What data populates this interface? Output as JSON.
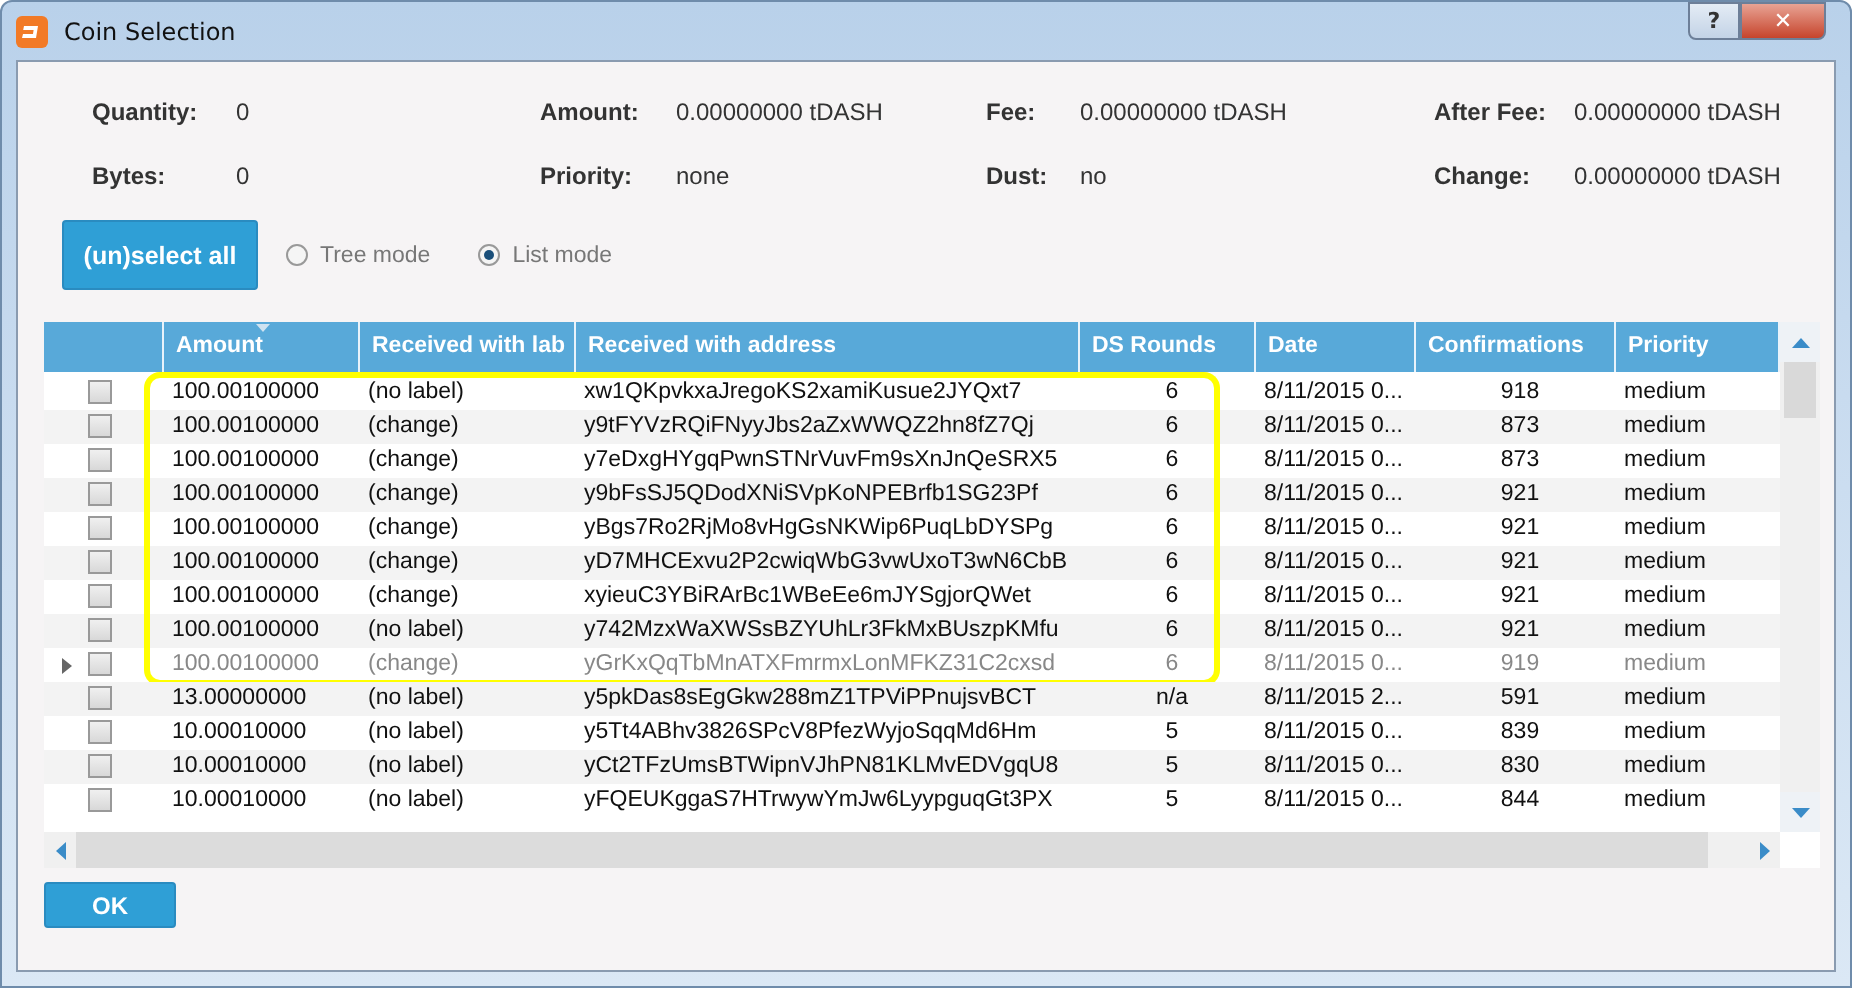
{
  "window": {
    "title": "Coin Selection",
    "help": "?",
    "close": "✕"
  },
  "summary": [
    {
      "label": "Quantity:",
      "value": "0"
    },
    {
      "label": "Amount:",
      "value": "0.00000000 tDASH"
    },
    {
      "label": "Fee:",
      "value": "0.00000000 tDASH"
    },
    {
      "label": "After Fee:",
      "value": "0.00000000 tDASH"
    },
    {
      "label": "Bytes:",
      "value": "0"
    },
    {
      "label": "Priority:",
      "value": "none"
    },
    {
      "label": "Dust:",
      "value": "no"
    },
    {
      "label": "Change:",
      "value": "0.00000000 tDASH"
    }
  ],
  "select_all": "(un)select all",
  "modes": [
    {
      "label": "Tree mode",
      "selected": false
    },
    {
      "label": "List mode",
      "selected": true
    }
  ],
  "table": {
    "columns": [
      "Amount",
      "Received with lab",
      "Received with address",
      "DS Rounds",
      "Date",
      "Confirmations",
      "Priority"
    ],
    "rows": [
      {
        "checked": false,
        "current": false,
        "greyed": false,
        "highlighted": true,
        "cells": [
          "100.00100000",
          "(no label)",
          "xw1QKpvkxaJregoKS2xamiKusue2JYQxt7",
          "6",
          "8/11/2015 0...",
          "918",
          "medium"
        ]
      },
      {
        "checked": false,
        "current": false,
        "greyed": false,
        "highlighted": true,
        "cells": [
          "100.00100000",
          "(change)",
          "y9tFYVzRQiFNyyJbs2aZxWWQZ2hn8fZ7Qj",
          "6",
          "8/11/2015 0...",
          "873",
          "medium"
        ]
      },
      {
        "checked": false,
        "current": false,
        "greyed": false,
        "highlighted": true,
        "cells": [
          "100.00100000",
          "(change)",
          "y7eDxgHYgqPwnSTNrVuvFm9sXnJnQeSRX5",
          "6",
          "8/11/2015 0...",
          "873",
          "medium"
        ]
      },
      {
        "checked": false,
        "current": false,
        "greyed": false,
        "highlighted": true,
        "cells": [
          "100.00100000",
          "(change)",
          "y9bFsSJ5QDodXNiSVpKoNPEBrfb1SG23Pf",
          "6",
          "8/11/2015 0...",
          "921",
          "medium"
        ]
      },
      {
        "checked": false,
        "current": false,
        "greyed": false,
        "highlighted": true,
        "cells": [
          "100.00100000",
          "(change)",
          "yBgs7Ro2RjMo8vHgGsNKWip6PuqLbDYSPg",
          "6",
          "8/11/2015 0...",
          "921",
          "medium"
        ]
      },
      {
        "checked": false,
        "current": false,
        "greyed": false,
        "highlighted": true,
        "cells": [
          "100.00100000",
          "(change)",
          "yD7MHCExvu2P2cwiqWbG3vwUxoT3wN6CbB",
          "6",
          "8/11/2015 0...",
          "921",
          "medium"
        ]
      },
      {
        "checked": false,
        "current": false,
        "greyed": false,
        "highlighted": true,
        "cells": [
          "100.00100000",
          "(change)",
          "xyieuC3YBiRArBc1WBeEe6mJYSgjorQWet",
          "6",
          "8/11/2015 0...",
          "921",
          "medium"
        ]
      },
      {
        "checked": false,
        "current": false,
        "greyed": false,
        "highlighted": true,
        "cells": [
          "100.00100000",
          "(no label)",
          "y742MzxWaXWSsBZYUhLr3FkMxBUszpKMfu",
          "6",
          "8/11/2015 0...",
          "921",
          "medium"
        ]
      },
      {
        "checked": false,
        "current": true,
        "greyed": true,
        "highlighted": true,
        "cells": [
          "100.00100000",
          "(change)",
          "yGrKxQqTbMnATXFmrmxLonMFKZ31C2cxsd",
          "6",
          "8/11/2015 0...",
          "919",
          "medium"
        ]
      },
      {
        "checked": false,
        "current": false,
        "greyed": false,
        "highlighted": false,
        "cells": [
          "13.00000000",
          "(no label)",
          "y5pkDas8sEgGkw288mZ1TPViPPnujsvBCT",
          "n/a",
          "8/11/2015 2...",
          "591",
          "medium"
        ]
      },
      {
        "checked": false,
        "current": false,
        "greyed": false,
        "highlighted": false,
        "cells": [
          "10.00010000",
          "(no label)",
          "y5Tt4ABhv3826SPcV8PfezWyjoSqqMd6Hm",
          "5",
          "8/11/2015 0...",
          "839",
          "medium"
        ]
      },
      {
        "checked": false,
        "current": false,
        "greyed": false,
        "highlighted": false,
        "cells": [
          "10.00010000",
          "(no label)",
          "yCt2TFzUmsBTWipnVJhPN81KLMvEDVgqU8",
          "5",
          "8/11/2015 0...",
          "830",
          "medium"
        ]
      },
      {
        "checked": false,
        "current": false,
        "greyed": false,
        "highlighted": false,
        "cells": [
          "10.00010000",
          "(no label)",
          "yFQEUKggaS7HTrwywYmJw6LyypguqGt3PX",
          "5",
          "8/11/2015 0...",
          "844",
          "medium"
        ]
      }
    ]
  },
  "ok": "OK"
}
